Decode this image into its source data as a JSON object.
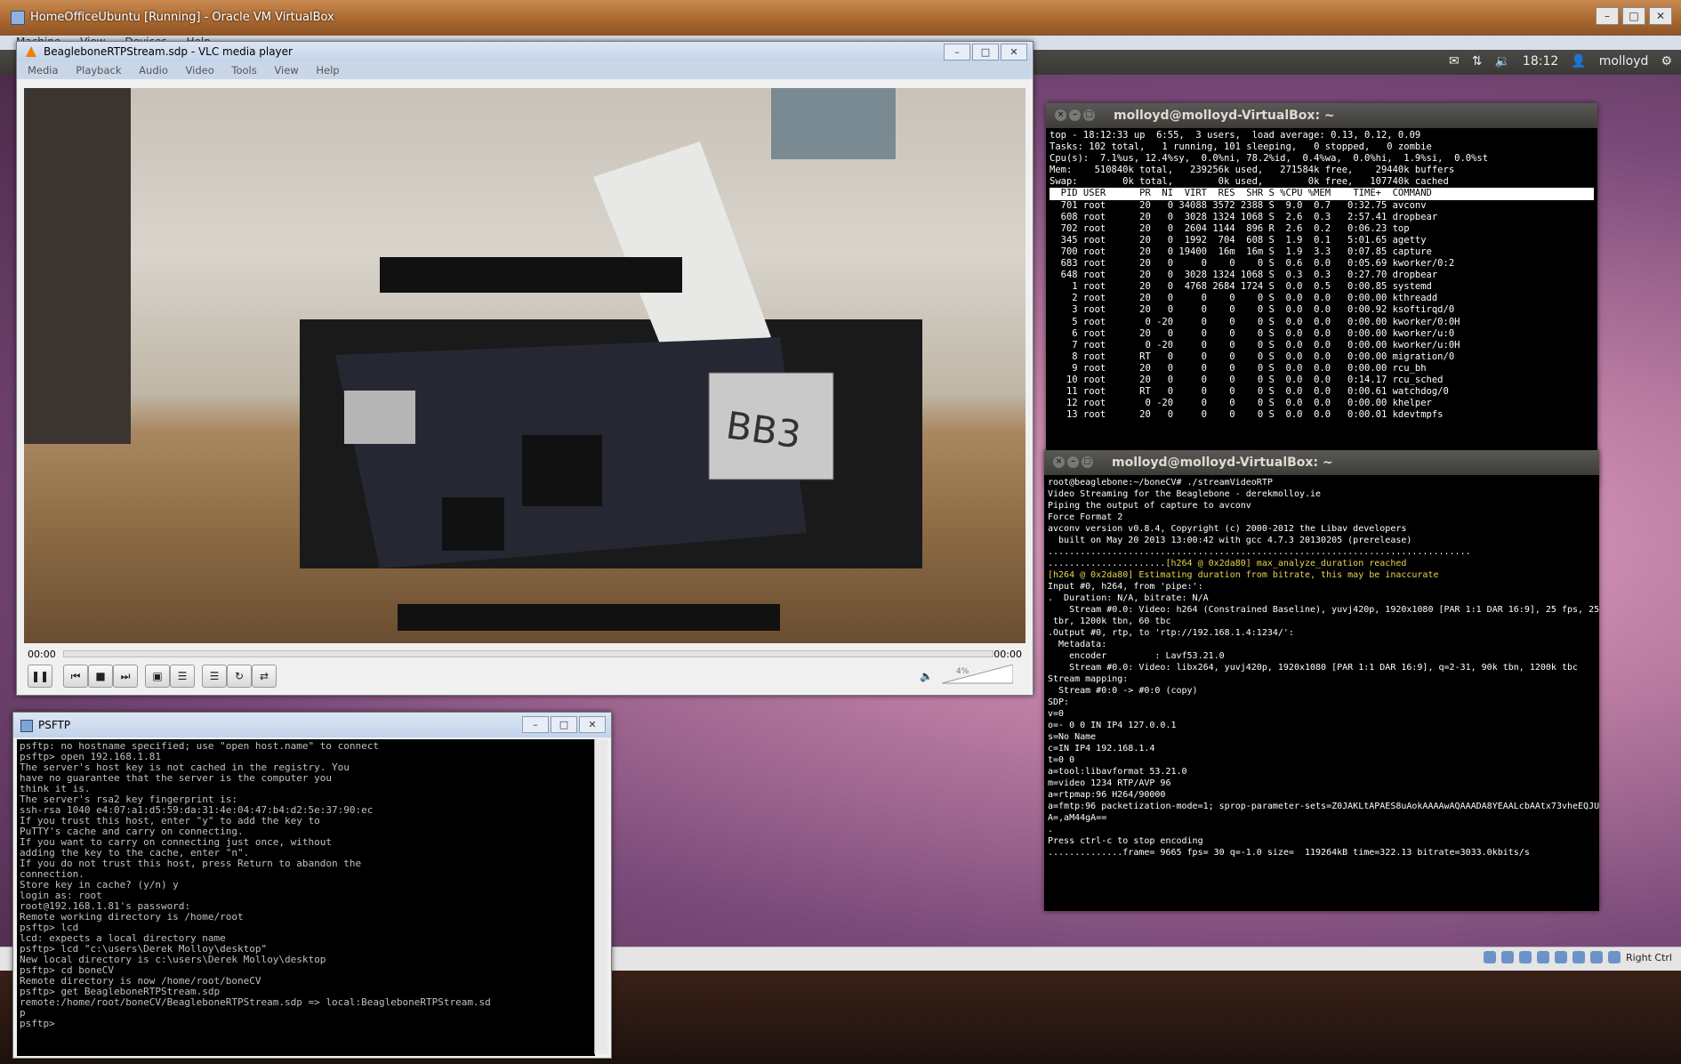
{
  "host": {
    "title": "HomeOfficeUbuntu [Running] - Oracle VM VirtualBox",
    "menu": [
      "Machine",
      "View",
      "Devices",
      "Help"
    ],
    "host_key": "Right Ctrl"
  },
  "ubuntu_panel": {
    "time": "18:12",
    "user": "molloyd"
  },
  "vlc": {
    "title": "BeagleboneRTPStream.sdp - VLC media player",
    "menu": [
      "Media",
      "Playback",
      "Audio",
      "Video",
      "Tools",
      "View",
      "Help"
    ],
    "time_elapsed": "00:00",
    "time_total": "00:00",
    "volume": "4%",
    "video_label": "BB3"
  },
  "top_terminal": {
    "title": "molloyd@molloyd-VirtualBox: ~",
    "summary": [
      "top - 18:12:33 up  6:55,  3 users,  load average: 0.13, 0.12, 0.09",
      "Tasks: 102 total,   1 running, 101 sleeping,   0 stopped,   0 zombie",
      "Cpu(s):  7.1%us, 12.4%sy,  0.0%ni, 78.2%id,  0.4%wa,  0.0%hi,  1.9%si,  0.0%st",
      "Mem:    510840k total,   239256k used,   271584k free,    29440k buffers",
      "Swap:        0k total,        0k used,        0k free,   107740k cached"
    ],
    "header": "  PID USER      PR  NI  VIRT  RES  SHR S %CPU %MEM    TIME+  COMMAND",
    "rows": [
      "  701 root      20   0 34088 3572 2388 S  9.0  0.7   0:32.75 avconv",
      "  608 root      20   0  3028 1324 1068 S  2.6  0.3   2:57.41 dropbear",
      "  702 root      20   0  2604 1144  896 R  2.6  0.2   0:06.23 top",
      "  345 root      20   0  1992  704  608 S  1.9  0.1   5:01.65 agetty",
      "  700 root      20   0 19400  16m  16m S  1.9  3.3   0:07.85 capture",
      "  683 root      20   0     0    0    0 S  0.6  0.0   0:05.69 kworker/0:2",
      "  648 root      20   0  3028 1324 1068 S  0.3  0.3   0:27.70 dropbear",
      "    1 root      20   0  4768 2684 1724 S  0.0  0.5   0:00.85 systemd",
      "    2 root      20   0     0    0    0 S  0.0  0.0   0:00.00 kthreadd",
      "    3 root      20   0     0    0    0 S  0.0  0.0   0:00.92 ksoftirqd/0",
      "    5 root       0 -20     0    0    0 S  0.0  0.0   0:00.00 kworker/0:0H",
      "    6 root      20   0     0    0    0 S  0.0  0.0   0:00.00 kworker/u:0",
      "    7 root       0 -20     0    0    0 S  0.0  0.0   0:00.00 kworker/u:0H",
      "    8 root      RT   0     0    0    0 S  0.0  0.0   0:00.00 migration/0",
      "    9 root      20   0     0    0    0 S  0.0  0.0   0:00.00 rcu_bh",
      "   10 root      20   0     0    0    0 S  0.0  0.0   0:14.17 rcu_sched",
      "   11 root      RT   0     0    0    0 S  0.0  0.0   0:00.61 watchdog/0",
      "   12 root       0 -20     0    0    0 S  0.0  0.0   0:00.00 khelper",
      "   13 root      20   0     0    0    0 S  0.0  0.0   0:00.01 kdevtmpfs"
    ]
  },
  "stream_terminal": {
    "title": "molloyd@molloyd-VirtualBox: ~",
    "lines_top": [
      "root@beaglebone:~/boneCV# ./streamVideoRTP",
      "Video Streaming for the Beaglebone - derekmolloy.ie",
      "Piping the output of capture to avconv",
      "Force Format 2",
      "avconv version v0.8.4, Copyright (c) 2000-2012 the Libav developers",
      "  built on May 20 2013 13:00:42 with gcc 4.7.3 20130205 (prerelease)",
      "..............................................................................."
    ],
    "warn_prefix": "......................",
    "warn1": "[h264 @ 0x2da80] max_analyze_duration reached",
    "warn2": "[h264 @ 0x2da80] Estimating duration from bitrate, this may be inaccurate",
    "lines_bottom": [
      "Input #0, h264, from 'pipe:':",
      ".  Duration: N/A, bitrate: N/A",
      "    Stream #0.0: Video: h264 (Constrained Baseline), yuvj420p, 1920x1080 [PAR 1:1 DAR 16:9], 25 fps, 25",
      " tbr, 1200k tbn, 60 tbc",
      ".Output #0, rtp, to 'rtp://192.168.1.4:1234/':",
      "  Metadata:",
      "    encoder         : Lavf53.21.0",
      "    Stream #0.0: Video: libx264, yuvj420p, 1920x1080 [PAR 1:1 DAR 16:9], q=2-31, 90k tbn, 1200k tbc",
      "Stream mapping:",
      "  Stream #0:0 -> #0:0 (copy)",
      "SDP:",
      "v=0",
      "o=- 0 0 IN IP4 127.0.0.1",
      "s=No Name",
      "c=IN IP4 192.168.1.4",
      "t=0 0",
      "a=tool:libavformat 53.21.0",
      "m=video 1234 RTP/AVP 96",
      "a=rtpmap:96 H264/90000",
      "a=fmtp:96 packetization-mode=1; sprop-parameter-sets=Z0JAKLtAPAES8uAokAAAAwAQAAADA8YEAALcbAAtx73vheEQJU",
      "A=,aM44gA==",
      ".",
      "Press ctrl-c to stop encoding",
      "..............frame= 9665 fps= 30 q=-1.0 size=  119264kB time=322.13 bitrate=3033.0kbits/s"
    ]
  },
  "psftp": {
    "title": "PSFTP",
    "lines": [
      "psftp: no hostname specified; use \"open host.name\" to connect",
      "psftp> open 192.168.1.81",
      "The server's host key is not cached in the registry. You",
      "have no guarantee that the server is the computer you",
      "think it is.",
      "The server's rsa2 key fingerprint is:",
      "ssh-rsa 1040 e4:07:a1:d5:59:da:31:4e:04:47:b4:d2:5e:37:90:ec",
      "If you trust this host, enter \"y\" to add the key to",
      "PuTTY's cache and carry on connecting.",
      "If you want to carry on connecting just once, without",
      "adding the key to the cache, enter \"n\".",
      "If you do not trust this host, press Return to abandon the",
      "connection.",
      "Store key in cache? (y/n) y",
      "login as: root",
      "root@192.168.1.81's password:",
      "Remote working directory is /home/root",
      "psftp> lcd",
      "lcd: expects a local directory name",
      "psftp> lcd \"c:\\users\\Derek Molloy\\desktop\"",
      "New local directory is c:\\users\\Derek Molloy\\desktop",
      "psftp> cd boneCV",
      "Remote directory is now /home/root/boneCV",
      "psftp> get BeagleboneRTPStream.sdp",
      "remote:/home/root/boneCV/BeagleboneRTPStream.sdp => local:BeagleboneRTPStream.sd",
      "p",
      "psftp>"
    ]
  }
}
